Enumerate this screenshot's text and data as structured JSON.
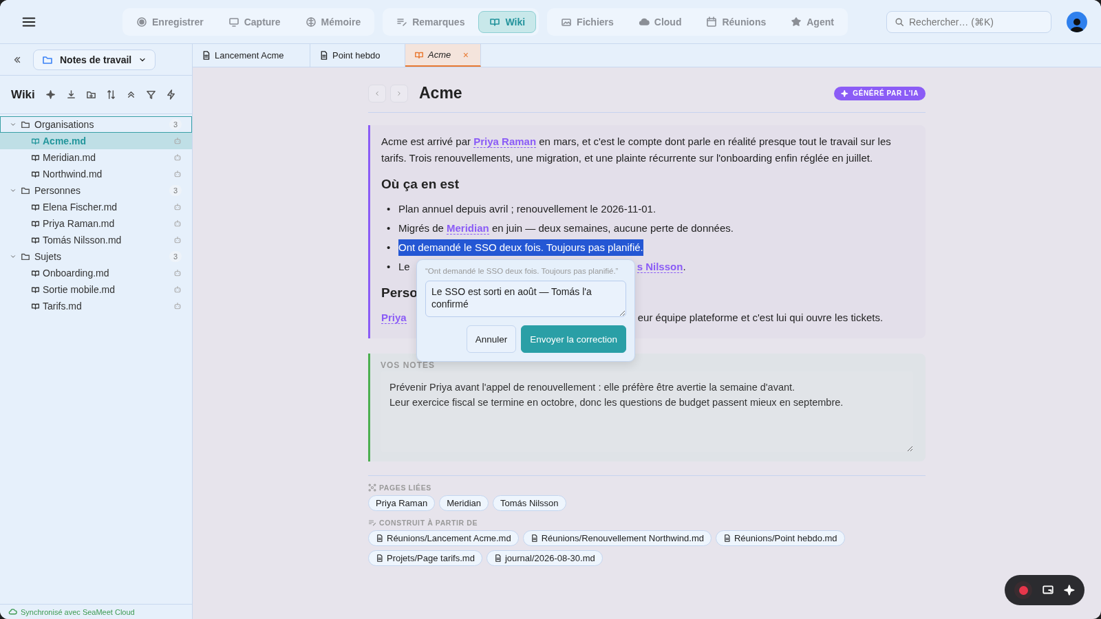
{
  "nav_groups": [
    {
      "items": [
        {
          "label": "Enregistrer",
          "selected": false
        },
        {
          "label": "Capture",
          "selected": false
        },
        {
          "label": "Mémoire",
          "selected": false
        }
      ]
    },
    {
      "items": [
        {
          "label": "Remarques",
          "selected": false
        },
        {
          "label": "Wiki",
          "selected": true
        }
      ]
    },
    {
      "items": [
        {
          "label": "Fichiers",
          "selected": false
        },
        {
          "label": "Cloud",
          "selected": false
        },
        {
          "label": "Réunions",
          "selected": false
        },
        {
          "label": "Agent",
          "selected": false
        }
      ]
    }
  ],
  "search": {
    "placeholder": "Rechercher… (⌘K)"
  },
  "sidebar": {
    "workspace": "Notes de travail",
    "title": "Wiki",
    "tree": [
      {
        "label": "Organisations",
        "count": "3",
        "expanded": true,
        "focused": true,
        "children": [
          {
            "label": "Acme.md",
            "selected": true
          },
          {
            "label": "Meridian.md",
            "selected": false
          },
          {
            "label": "Northwind.md",
            "selected": false
          }
        ]
      },
      {
        "label": "Personnes",
        "count": "3",
        "expanded": true,
        "focused": false,
        "children": [
          {
            "label": "Elena Fischer.md",
            "selected": false
          },
          {
            "label": "Priya Raman.md",
            "selected": false
          },
          {
            "label": "Tomás Nilsson.md",
            "selected": false
          }
        ]
      },
      {
        "label": "Sujets",
        "count": "3",
        "expanded": true,
        "focused": false,
        "children": [
          {
            "label": "Onboarding.md",
            "selected": false
          },
          {
            "label": "Sortie mobile.md",
            "selected": false
          },
          {
            "label": "Tarifs.md",
            "selected": false
          }
        ]
      }
    ],
    "status": "Synchronisé avec SeaMeet Cloud"
  },
  "tabs": [
    {
      "label": "Lancement Acme",
      "selected": false
    },
    {
      "label": "Point hebdo",
      "selected": false
    },
    {
      "label": "Acme",
      "selected": true,
      "close": "×"
    }
  ],
  "page": {
    "title": "Acme",
    "badge": "GÉNÉRÉ PAR L'IA",
    "summary": {
      "intro": [
        {
          "kind": "text",
          "text": "Acme est arrivé par "
        },
        {
          "kind": "link",
          "text": "Priya Raman"
        },
        {
          "kind": "text",
          "text": " en mars, et c'est le compte dont parle en réalité presque tout le travail sur les tarifs. Trois renouvellements, une migration, et une plainte récurrente sur l'onboarding enfin réglée en juillet."
        }
      ],
      "heading": "Où ça en est",
      "bullet": "•",
      "bullets": [
        {
          "highlighted": false,
          "parts": [
            {
              "kind": "text",
              "text": "Plan annuel depuis avril ; renouvellement le 2026-11-01."
            }
          ]
        },
        {
          "highlighted": false,
          "parts": [
            {
              "kind": "text",
              "text": "Migrés de "
            },
            {
              "kind": "link",
              "text": "Meridian"
            },
            {
              "kind": "text",
              "text": " en juin — deux semaines, aucune perte de données."
            }
          ]
        },
        {
          "highlighted": true,
          "parts": [
            {
              "kind": "text",
              "text": "Ont demandé le SSO deux fois. Toujours pas planifié."
            }
          ]
        },
        {
          "highlighted": false,
          "parts": [
            {
              "kind": "text",
              "text": "Le"
            },
            {
              "kind": "covered"
            },
            {
              "kind": "link",
              "text": "s Nilsson"
            },
            {
              "kind": "text",
              "text": "."
            }
          ]
        }
      ],
      "heading_2": "Perso",
      "paragraph": [
        {
          "kind": "link",
          "text": "Priya"
        },
        {
          "kind": "covered"
        },
        {
          "kind": "text",
          "text": "eur équipe plateforme et c'est lui qui ouvre les tickets."
        }
      ]
    },
    "notes": {
      "label": "VOS NOTES",
      "value": "Prévenir Priya avant l'appel de renouvellement : elle préfère être avertie la semaine d'avant.\nLeur exercice fiscal se termine en octobre, donc les questions de budget passent mieux en septembre."
    },
    "linked": {
      "label": "PAGES LIÉES",
      "items": [
        "Priya Raman",
        "Meridian",
        "Tomás Nilsson"
      ]
    },
    "sources": {
      "label": "CONSTRUIT À PARTIR DE",
      "items": [
        "Réunions/Lancement Acme.md",
        "Réunions/Renouvellement Northwind.md",
        "Réunions/Point hebdo.md",
        "Projets/Page tarifs.md",
        "journal/2026-08-30.md"
      ]
    }
  },
  "correction": {
    "quote": "“Ont demandé le SSO deux fois. Toujours pas planifié.”",
    "value": "Le SSO est sorti en août — Tomás l'a confirmé",
    "cancel": "Annuler",
    "submit": "Envoyer la correction"
  },
  "recorder": {
    "recording": true
  }
}
